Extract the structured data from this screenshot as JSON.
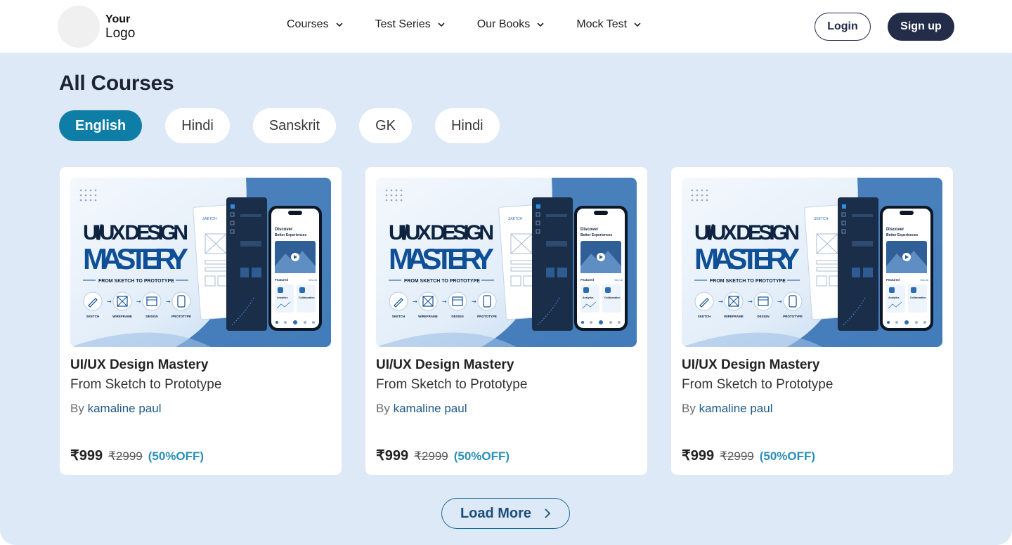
{
  "logo": {
    "line1": "Your",
    "line2": "Logo"
  },
  "nav": [
    {
      "label": "Courses"
    },
    {
      "label": "Test Series"
    },
    {
      "label": "Our Books"
    },
    {
      "label": "Mock Test"
    }
  ],
  "auth": {
    "login": "Login",
    "signup": "Sign up"
  },
  "page": {
    "title": "All Courses"
  },
  "filters": [
    {
      "label": "English",
      "active": true
    },
    {
      "label": "Hindi"
    },
    {
      "label": "Sanskrit"
    },
    {
      "label": "GK"
    },
    {
      "label": "Hindi"
    }
  ],
  "thumbnail": {
    "headline1": "UI/UX DESIGN",
    "headline2": "MASTERY",
    "tagline": "FROM SKETCH TO PROTOTYPE",
    "steps": [
      "SKETCH",
      "WIREFRAME",
      "DESIGN",
      "PROTOTYPE"
    ],
    "sketch_note": "SKETCH",
    "phone_heading1": "Discover",
    "phone_heading2": "Better Experiences",
    "phone_featured": "Featured",
    "phone_view_all": "View all",
    "phone_tile1": "Analytics",
    "phone_tile2": "Collaboration"
  },
  "courses": [
    {
      "title": "UI/UX Design Mastery",
      "subtitle": "From Sketch to Prototype",
      "by": "By",
      "author": "kamaline paul",
      "price": "₹999",
      "old_price": "₹2999",
      "discount": "(50%OFF)"
    },
    {
      "title": "UI/UX Design Mastery",
      "subtitle": "From Sketch to Prototype",
      "by": "By",
      "author": "kamaline paul",
      "price": "₹999",
      "old_price": "₹2999",
      "discount": "(50%OFF)"
    },
    {
      "title": "UI/UX Design Mastery",
      "subtitle": "From Sketch to Prototype",
      "by": "By",
      "author": "kamaline paul",
      "price": "₹999",
      "old_price": "₹2999",
      "discount": "(50%OFF)"
    }
  ],
  "load_more": {
    "label": "Load More"
  },
  "colors": {
    "primary": "#0f7ea7",
    "dark": "#232c48",
    "panel": "#dde9f7",
    "accent": "#2a8fb8"
  }
}
